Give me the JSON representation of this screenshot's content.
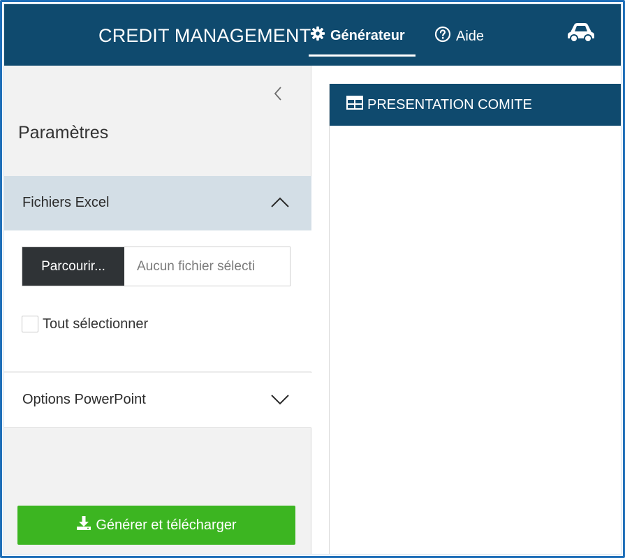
{
  "app": {
    "title": "CREDIT MANAGEMENT"
  },
  "nav": {
    "items": [
      {
        "label": "Générateur",
        "icon": "gear-icon",
        "active": true
      },
      {
        "label": "Aide",
        "icon": "question-circle-icon",
        "active": false
      }
    ],
    "right_icon": "car-icon"
  },
  "sidebar": {
    "title": "Paramètres",
    "collapse_icon": "chevron-left-icon",
    "sections": [
      {
        "title": "Fichiers Excel",
        "expanded": true,
        "browse_label": "Parcourir...",
        "file_placeholder": "Aucun fichier sélecti",
        "select_all_label": "Tout sélectionner",
        "select_all_checked": false
      },
      {
        "title": "Options PowerPoint",
        "expanded": false
      }
    ],
    "generate_label": "Générer et télécharger"
  },
  "main": {
    "panel_title": "PRESENTATION COMITE",
    "panel_icon": "table-icon"
  },
  "colors": {
    "header": "#0f4a6e",
    "accordion_active": "#d3dee6",
    "primary_button": "#3cb521",
    "browse_button": "#2f3336"
  }
}
